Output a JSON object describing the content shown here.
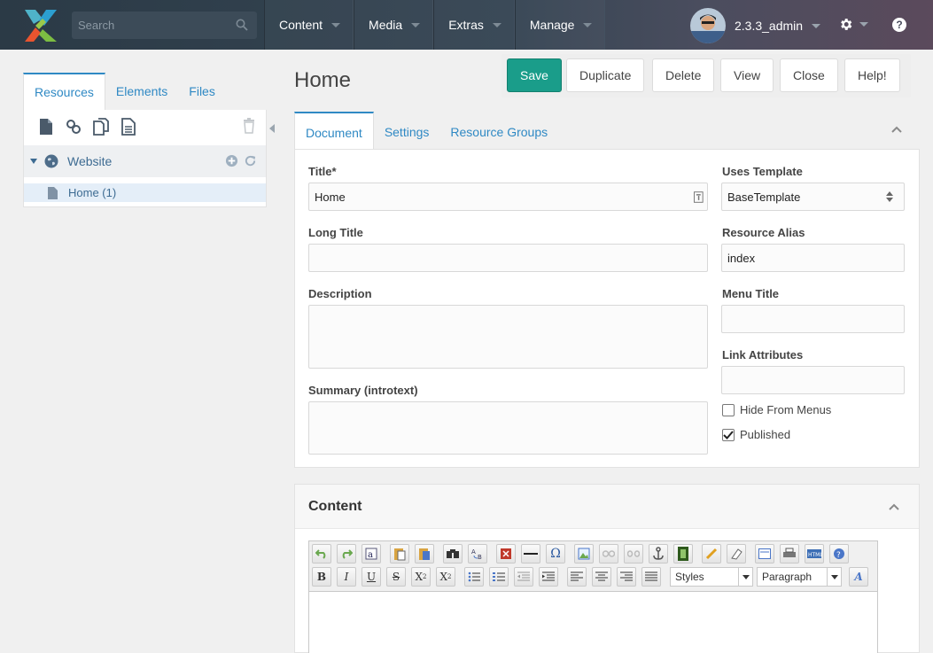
{
  "search": {
    "placeholder": "Search"
  },
  "nav": {
    "items": [
      "Content",
      "Media",
      "Extras",
      "Manage"
    ]
  },
  "user": {
    "name": "2.3.3_admin"
  },
  "help": {
    "label": "?"
  },
  "left_panel": {
    "tabs": [
      "Resources",
      "Elements",
      "Files"
    ],
    "tree": {
      "root": "Website",
      "child": "Home (1)"
    }
  },
  "page": {
    "title": "Home"
  },
  "actions": [
    "Save",
    "Duplicate",
    "Delete",
    "View",
    "Close",
    "Help!"
  ],
  "doc_tabs": [
    "Document",
    "Settings",
    "Resource Groups"
  ],
  "form": {
    "title_label": "Title*",
    "title_value": "Home",
    "long_title_label": "Long Title",
    "description_label": "Description",
    "summary_label": "Summary (introtext)",
    "template_label": "Uses Template",
    "template_value": "BaseTemplate",
    "alias_label": "Resource Alias",
    "alias_value": "index",
    "menu_title_label": "Menu Title",
    "link_attr_label": "Link Attributes",
    "hide_menus_label": "Hide From Menus",
    "hide_menus_checked": false,
    "published_label": "Published",
    "published_checked": true
  },
  "content": {
    "title": "Content",
    "styles_select": "Styles",
    "format_select": "Paragraph"
  },
  "colors": {
    "accent": "#2f89c4",
    "primary_button": "#1a9d8a"
  }
}
